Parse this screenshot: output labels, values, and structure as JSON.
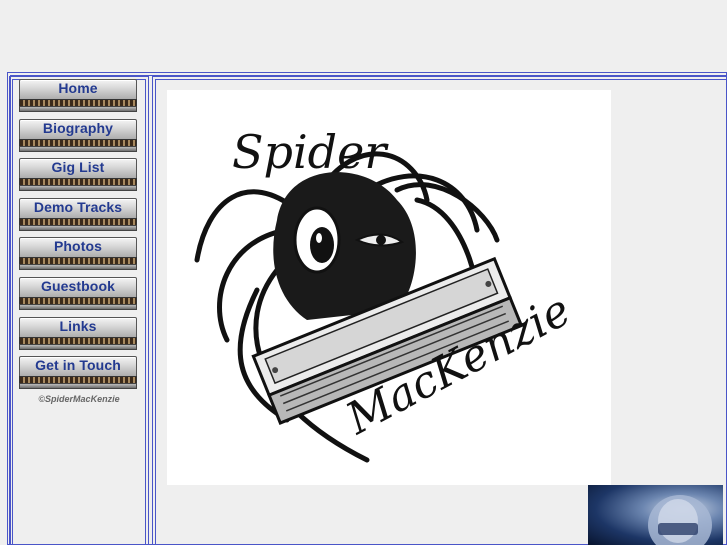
{
  "nav": {
    "items": [
      {
        "label": "Home"
      },
      {
        "label": "Biography"
      },
      {
        "label": "Gig List"
      },
      {
        "label": "Demo Tracks"
      },
      {
        "label": "Photos"
      },
      {
        "label": "Guestbook"
      },
      {
        "label": "Links"
      },
      {
        "label": "Get in Touch"
      }
    ]
  },
  "copyright": "©SpiderMacKenzie",
  "logo": {
    "line1": "Spider",
    "line2": "MacKenzie"
  },
  "colors": {
    "frame": "#4a55c8",
    "nav_text": "#233a90",
    "background": "#efefef"
  }
}
